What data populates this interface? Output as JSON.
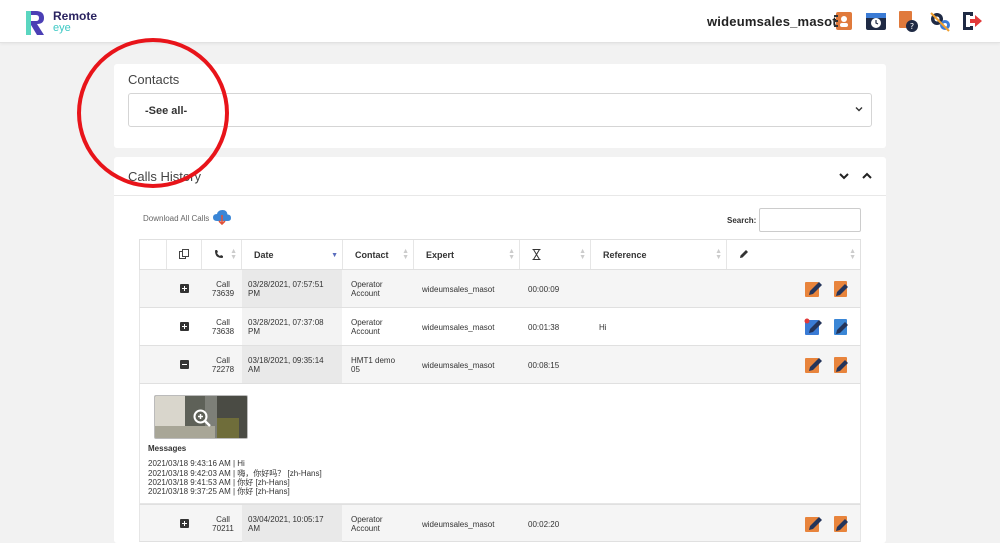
{
  "app": {
    "name": "Remote",
    "sub": "eye",
    "brand_color": "#2a2360",
    "accent": "#3cc8c4"
  },
  "header": {
    "username": "wideumsales_masot",
    "icons": [
      "contacts-book-icon",
      "history-clock-icon",
      "help-document-icon",
      "settings-gears-icon",
      "logout-icon"
    ]
  },
  "contacts": {
    "title": "Contacts",
    "selected": "-See all-"
  },
  "calls": {
    "title": "Calls History",
    "download_label": "Download All Calls",
    "search_label": "Search:",
    "search_value": "",
    "columns": [
      "",
      "copy-icon",
      "phone-icon",
      "Date",
      "Contact",
      "Expert",
      "hourglass-icon",
      "Reference",
      "pencil-icon",
      ""
    ],
    "rows": [
      {
        "call_label": "Call",
        "call_id": "73639",
        "date1": "03/28/2021, 07:57:51",
        "date2": "PM",
        "contact1": "Operator",
        "contact2": "Account",
        "expert": "wideumsales_masot",
        "duration": "00:00:09",
        "reference": "",
        "expanded": false
      },
      {
        "call_label": "Call",
        "call_id": "73638",
        "date1": "03/28/2021, 07:37:08",
        "date2": "PM",
        "contact1": "Operator",
        "contact2": "Account",
        "expert": "wideumsales_masot",
        "duration": "00:01:38",
        "reference": "Hi",
        "expanded": false
      },
      {
        "call_label": "Call",
        "call_id": "72278",
        "date1": "03/18/2021, 09:35:14",
        "date2": "AM",
        "contact1": "HMT1 demo",
        "contact2": "05",
        "expert": "wideumsales_masot",
        "duration": "00:08:15",
        "reference": "",
        "expanded": true
      },
      {
        "call_label": "Call",
        "call_id": "70211",
        "date1": "03/04/2021, 10:05:17",
        "date2": "AM",
        "contact1": "Operator",
        "contact2": "Account",
        "expert": "wideumsales_masot",
        "duration": "00:02:20",
        "reference": "",
        "expanded": false
      }
    ],
    "detail": {
      "messages_title": "Messages",
      "messages": [
        "2021/03/18 9:43:16 AM | Hi",
        "2021/03/18 9:42:03 AM | 嗨，你好吗？ [zh-Hans]",
        "2021/03/18 9:41:53 AM | 你好 [zh-Hans]",
        "2021/03/18 9:37:25 AM | 你好 [zh-Hans]"
      ]
    }
  }
}
